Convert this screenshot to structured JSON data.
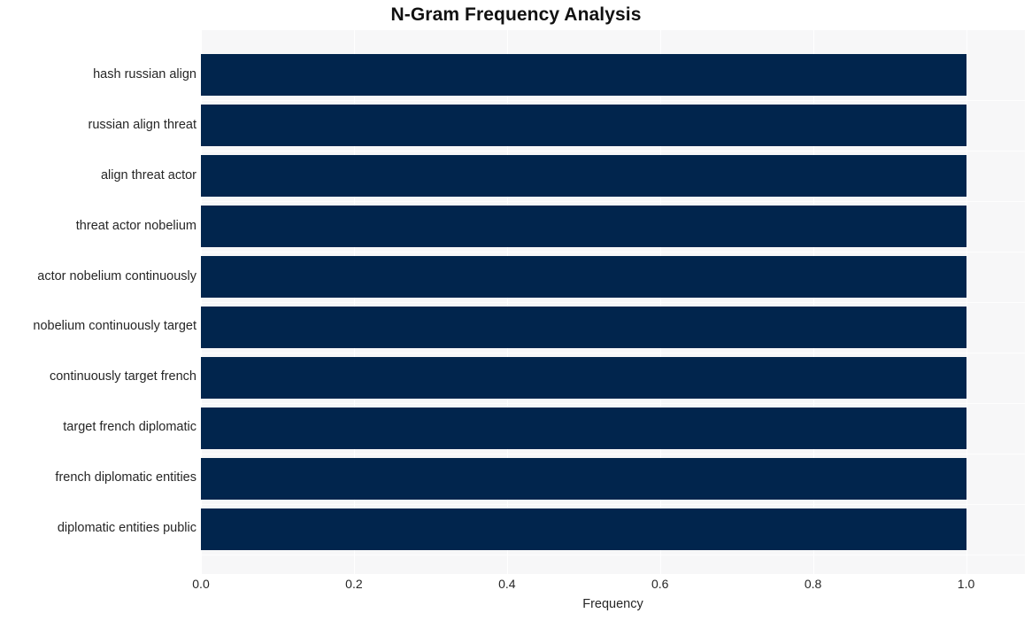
{
  "chart_data": {
    "type": "bar",
    "orientation": "horizontal",
    "title": "N-Gram Frequency Analysis",
    "xlabel": "Frequency",
    "ylabel": "",
    "categories": [
      "hash russian align",
      "russian align threat",
      "align threat actor",
      "threat actor nobelium",
      "actor nobelium continuously",
      "nobelium continuously target",
      "continuously target french",
      "target french diplomatic",
      "french diplomatic entities",
      "diplomatic entities public"
    ],
    "values": [
      1.0,
      1.0,
      1.0,
      1.0,
      1.0,
      1.0,
      1.0,
      1.0,
      1.0,
      1.0
    ],
    "xlim": [
      0.0,
      1.0769
    ],
    "xticks": [
      "0.0",
      "0.2",
      "0.4",
      "0.6",
      "0.8",
      "1.0"
    ],
    "xtick_values": [
      0.0,
      0.2,
      0.4,
      0.6,
      0.8,
      1.0
    ],
    "grid": true,
    "legend": null,
    "bar_color": "#01254d",
    "plot_background": "#f7f7f8",
    "figure_background": "#ffffff",
    "gridline_color": "#ffffff"
  }
}
